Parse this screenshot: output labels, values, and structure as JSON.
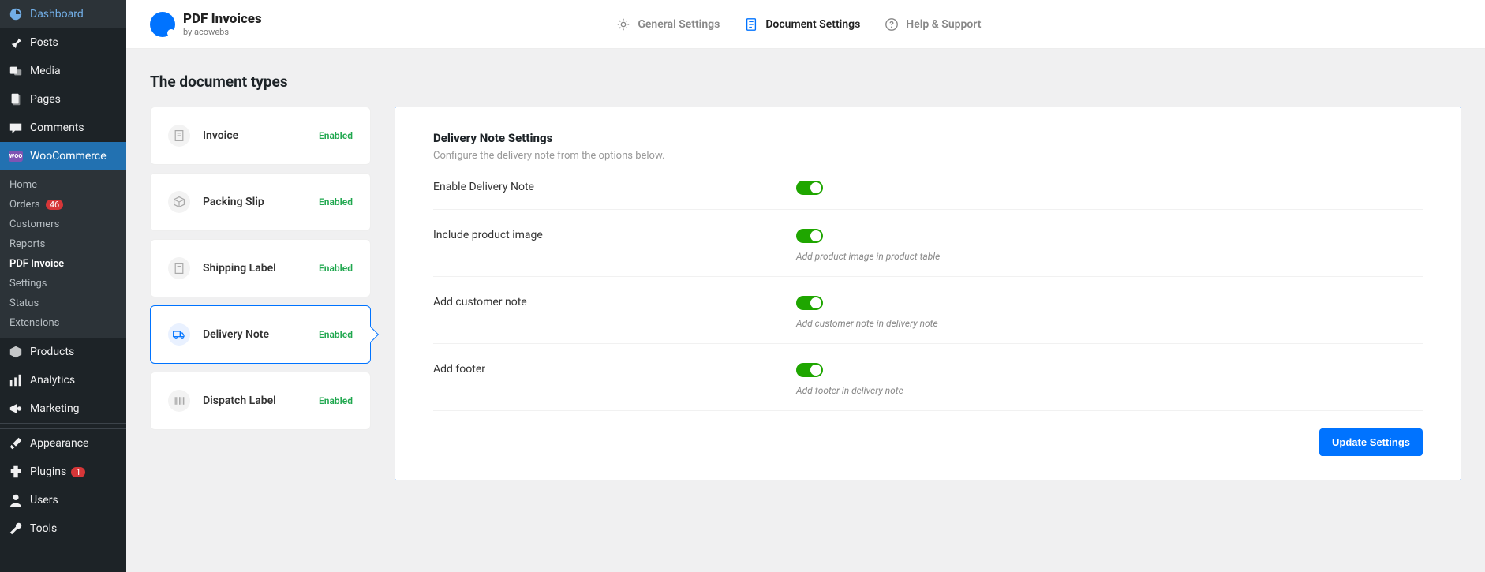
{
  "sidebar": {
    "items": [
      {
        "label": "Dashboard"
      },
      {
        "label": "Posts"
      },
      {
        "label": "Media"
      },
      {
        "label": "Pages"
      },
      {
        "label": "Comments"
      },
      {
        "label": "WooCommerce"
      },
      {
        "label": "Products"
      },
      {
        "label": "Analytics"
      },
      {
        "label": "Marketing"
      },
      {
        "label": "Appearance"
      },
      {
        "label": "Plugins"
      },
      {
        "label": "Users"
      },
      {
        "label": "Tools"
      }
    ],
    "submenu": [
      {
        "label": "Home"
      },
      {
        "label": "Orders",
        "badge": "46"
      },
      {
        "label": "Customers"
      },
      {
        "label": "Reports"
      },
      {
        "label": "PDF Invoice"
      },
      {
        "label": "Settings"
      },
      {
        "label": "Status"
      },
      {
        "label": "Extensions"
      }
    ],
    "plugins_badge": "1"
  },
  "brand": {
    "title": "PDF Invoices",
    "subtitle": "by acowebs"
  },
  "tabs": [
    {
      "label": "General Settings"
    },
    {
      "label": "Document Settings"
    },
    {
      "label": "Help & Support"
    }
  ],
  "page": {
    "heading": "The document types"
  },
  "doctypes": [
    {
      "name": "Invoice",
      "status": "Enabled"
    },
    {
      "name": "Packing Slip",
      "status": "Enabled"
    },
    {
      "name": "Shipping Label",
      "status": "Enabled"
    },
    {
      "name": "Delivery Note",
      "status": "Enabled"
    },
    {
      "name": "Dispatch Label",
      "status": "Enabled"
    }
  ],
  "panel": {
    "title": "Delivery Note Settings",
    "description": "Configure the delivery note from the options below.",
    "settings": [
      {
        "label": "Enable Delivery Note",
        "helper": "",
        "on": true
      },
      {
        "label": "Include product image",
        "helper": "Add product image in product table",
        "on": true
      },
      {
        "label": "Add customer note",
        "helper": "Add customer note in delivery note",
        "on": true
      },
      {
        "label": "Add footer",
        "helper": "Add footer in delivery note",
        "on": true
      }
    ],
    "save_label": "Update Settings"
  }
}
